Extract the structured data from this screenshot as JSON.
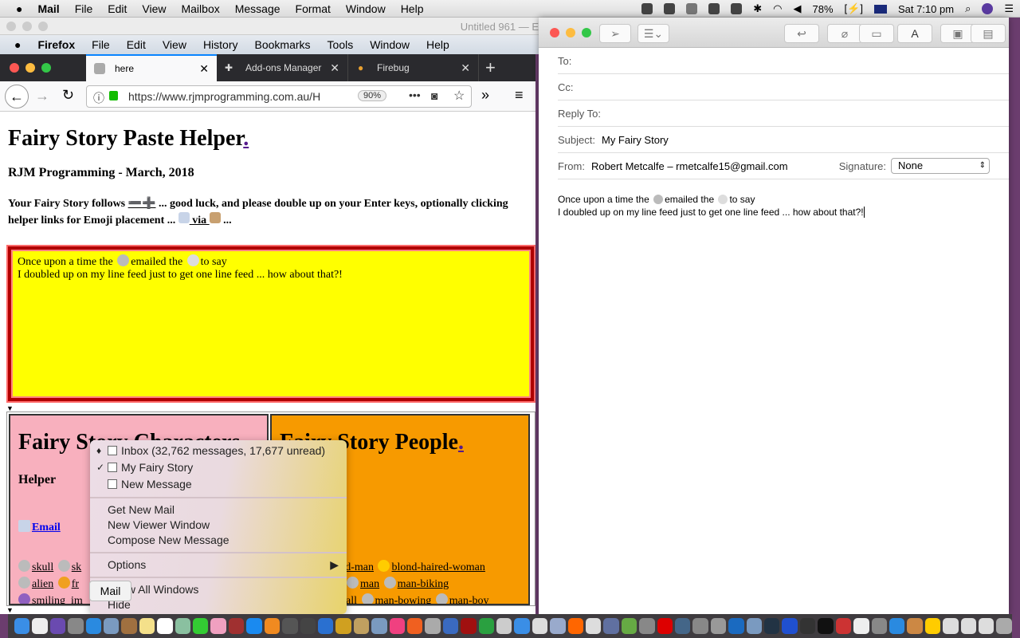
{
  "menubar": {
    "app": "Mail",
    "items": [
      "File",
      "Edit",
      "View",
      "Mailbox",
      "Message",
      "Format",
      "Window",
      "Help"
    ],
    "battery": "78%",
    "clock": "Sat 7:10 pm"
  },
  "behind_window": {
    "title": "Untitled 961 — E"
  },
  "firefox_menu": {
    "app": "Firefox",
    "items": [
      "File",
      "Edit",
      "View",
      "History",
      "Bookmarks",
      "Tools",
      "Window",
      "Help"
    ]
  },
  "tabs": [
    {
      "label": "here",
      "active": true
    },
    {
      "label": "Add-ons Manager"
    },
    {
      "label": "Firebug"
    }
  ],
  "address": {
    "url": "https://www.rjmprogramming.com.au/H",
    "zoom": "90%"
  },
  "page": {
    "title": "Fairy Story Paste Helper",
    "title_link": ".",
    "subtitle": "RJM Programming - March, 2018",
    "intro_1": "Your Fairy Story follows ",
    "minus_plus": "➖➕",
    "intro_2": " ... good luck, and please double up on your Enter keys, optionally clicking helper links for Emoji placement ... ",
    "via": " via ",
    "intro_3": " ...",
    "story": {
      "line1a": "Once upon a time the ",
      "line1b": "emailed the ",
      "line1c": "to say",
      "line2": "I doubled up on my line feed just to get one line feed ... how about that?!"
    },
    "characters": {
      "title": "Fairy Story Characters",
      "helper": "Helper",
      "email_link": "Email",
      "links_row1": [
        "skull",
        "sk"
      ],
      "links_row2": [
        "alien",
        "fr"
      ],
      "links_row3": [
        "smiling_im"
      ]
    },
    "people": {
      "title": "Fairy Story People",
      "title_link": ".",
      "links_row1": [
        "ed-man",
        "blond-haired-woman"
      ],
      "links_row2": [
        "man",
        "man-biking"
      ],
      "links_row3": [
        "ball",
        "man-bowing",
        "man-boy"
      ]
    }
  },
  "context_menu": {
    "items": [
      {
        "label": "Inbox (32,762 messages, 17,677 unread)",
        "mark": "♦"
      },
      {
        "label": "My Fairy Story",
        "mark": "✓"
      },
      {
        "label": "New Message"
      },
      {
        "label": "Get New Mail"
      },
      {
        "label": "New Viewer Window"
      },
      {
        "label": "Compose New Message"
      },
      {
        "label": "Options"
      },
      {
        "label": "Show All Windows"
      },
      {
        "label": "Hide"
      }
    ]
  },
  "tooltip": "Mail",
  "compose": {
    "to_label": "To:",
    "cc_label": "Cc:",
    "reply_label": "Reply To:",
    "subject_label": "Subject:",
    "subject": "My Fairy Story",
    "from_label": "From:",
    "from": "Robert Metcalfe – rmetcalfe15@gmail.com",
    "signature_label": "Signature:",
    "signature": "None",
    "body_1a": "Once upon a time the ",
    "body_1b": "emailed the ",
    "body_1c": "to say",
    "body_2": "I doubled up on my line feed just to get one line feed ... how about that?! ",
    "toolbar_format": "A"
  },
  "colors": {
    "story_bg": "#ffff00",
    "story_border": "#b00000",
    "characters_bg": "#f8b0be",
    "people_bg": "#f79a00",
    "tab_bar": "#2a2a2e",
    "accent": "#0a84ff"
  }
}
